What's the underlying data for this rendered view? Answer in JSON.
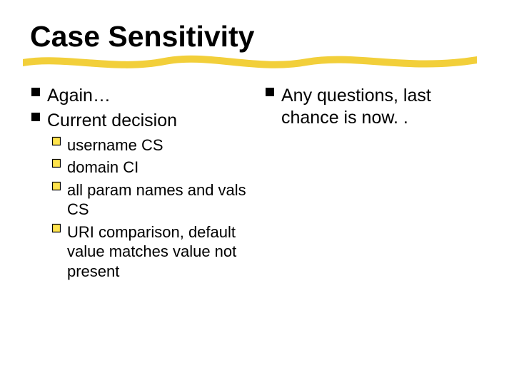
{
  "title": "Case Sensitivity",
  "left": {
    "items": [
      {
        "text": "Again…"
      },
      {
        "text": "Current decision"
      }
    ],
    "subitems": [
      {
        "text": "username CS"
      },
      {
        "text": "domain CI"
      },
      {
        "text": "all param names and vals CS"
      },
      {
        "text": "URI comparison, default value matches value not present"
      }
    ]
  },
  "right": {
    "items": [
      {
        "text": "Any questions, last chance is now. ."
      }
    ]
  }
}
